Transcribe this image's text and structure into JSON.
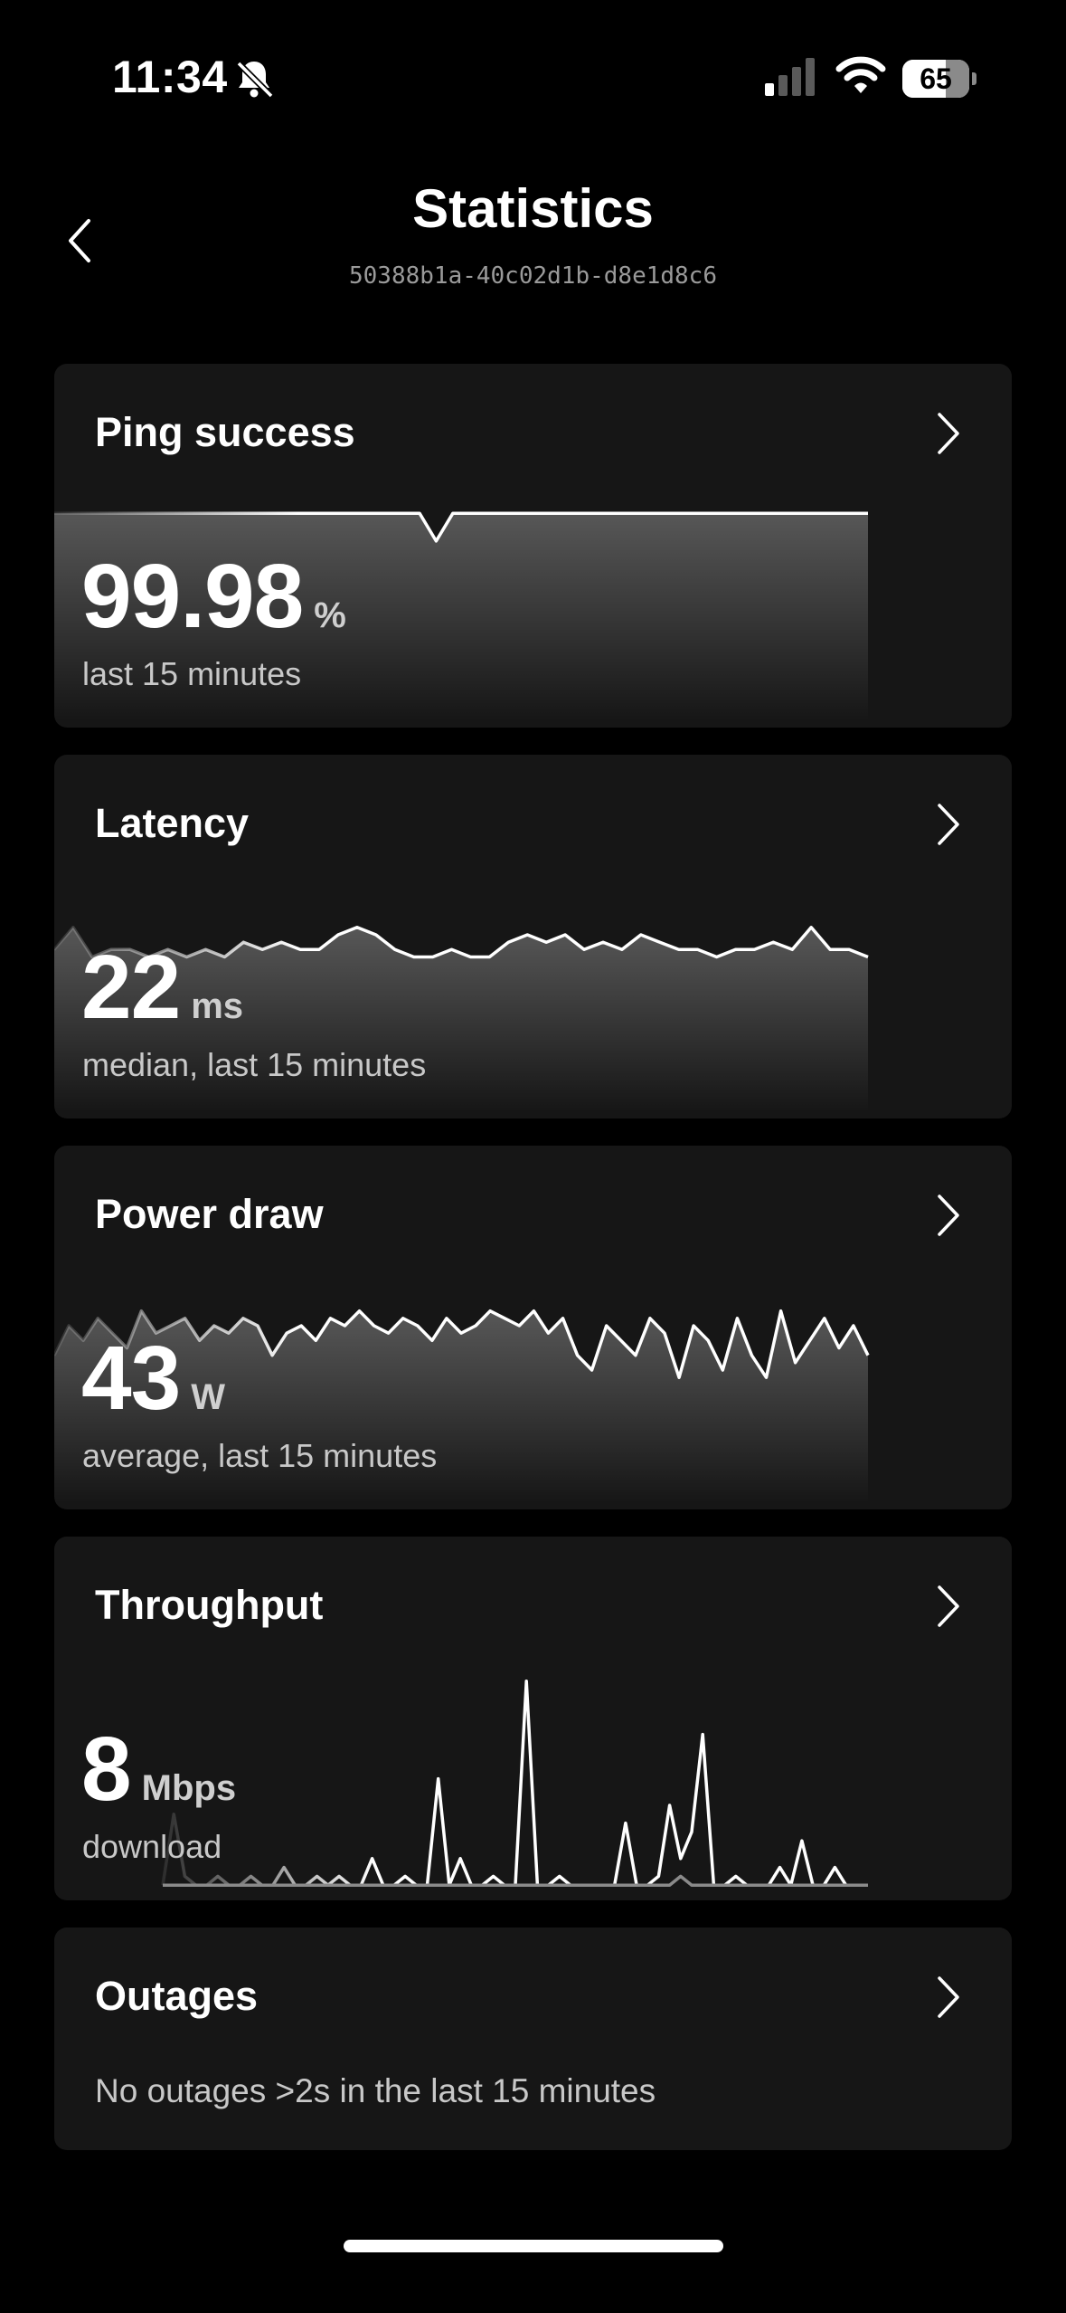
{
  "status_bar": {
    "time": "11:34",
    "battery": "65",
    "icons": [
      "bell-slash-icon",
      "cellular-signal-icon",
      "wifi-icon",
      "battery-icon"
    ]
  },
  "header": {
    "title": "Statistics",
    "subtitle": "50388b1a-40c02d1b-d8e1d8c6",
    "back_icon": "chevron-left-icon"
  },
  "cards": {
    "ping": {
      "title": "Ping success",
      "value": "99.98",
      "unit": "%",
      "caption": "last 15 minutes"
    },
    "latency": {
      "title": "Latency",
      "value": "22",
      "unit": "ms",
      "caption": "median, last 15 minutes"
    },
    "power": {
      "title": "Power draw",
      "value": "43",
      "unit": "W",
      "caption": "average, last 15 minutes"
    },
    "throughput": {
      "title": "Throughput",
      "value": "8",
      "unit": "Mbps",
      "caption": "download"
    },
    "outages": {
      "title": "Outages",
      "caption": "No outages >2s in the last 15 minutes"
    }
  },
  "chart_data": [
    {
      "type": "line",
      "name": "ping-sparkline",
      "values": [
        100,
        100,
        100,
        100,
        100,
        100,
        100,
        100,
        100,
        100,
        100,
        100,
        100,
        100,
        100,
        100,
        100,
        100,
        100,
        100,
        100,
        100,
        100,
        99.6,
        100,
        100,
        100,
        100,
        100,
        100,
        100,
        100,
        100,
        100,
        100,
        100,
        100,
        100,
        100,
        100,
        100,
        100,
        100,
        100,
        100,
        100,
        100,
        100,
        100,
        100
      ],
      "ylim": [
        97,
        100.2
      ]
    },
    {
      "type": "line",
      "name": "latency-sparkline",
      "values": [
        22,
        25,
        21,
        22,
        22,
        21,
        22,
        21,
        22,
        21,
        23,
        22,
        23,
        22,
        22,
        24,
        25,
        24,
        22,
        21,
        21,
        22,
        21,
        21,
        23,
        24,
        23,
        24,
        22,
        23,
        22,
        24,
        23,
        22,
        22,
        21,
        22,
        22,
        23,
        22,
        25,
        22,
        22,
        21
      ],
      "ylim": [
        0,
        30
      ]
    },
    {
      "type": "line",
      "name": "power-sparkline",
      "values": [
        40,
        44,
        42,
        45,
        43,
        41,
        46,
        43,
        44,
        45,
        42,
        44,
        43,
        45,
        44,
        40,
        43,
        44,
        42,
        45,
        44,
        46,
        44,
        43,
        45,
        44,
        42,
        45,
        43,
        44,
        46,
        45,
        44,
        46,
        43,
        45,
        40,
        38,
        44,
        42,
        40,
        45,
        43,
        37,
        44,
        42,
        38,
        45,
        40,
        37,
        46,
        39,
        42,
        45,
        41,
        44,
        40
      ],
      "ylim": [
        20,
        50
      ]
    },
    {
      "type": "line",
      "name": "throughput-download",
      "values": [
        1,
        9,
        2,
        1,
        1,
        2,
        1,
        1,
        2,
        1,
        1,
        3,
        1,
        1,
        2,
        1,
        2,
        1,
        1,
        4,
        1,
        1,
        2,
        1,
        1,
        13,
        1,
        4,
        1,
        1,
        2,
        1,
        1,
        24,
        1,
        1,
        2,
        1,
        1,
        1,
        1,
        1,
        8,
        1,
        1,
        2,
        10,
        4,
        7,
        18,
        1,
        1,
        2,
        1,
        1,
        1,
        3,
        1,
        6,
        1,
        1,
        3,
        1,
        1,
        1
      ],
      "ylim": [
        0,
        25
      ]
    },
    {
      "type": "line",
      "name": "throughput-upload",
      "values": [
        1,
        1,
        1,
        1,
        1,
        1,
        1,
        1,
        1,
        1,
        1,
        1,
        1,
        1,
        1,
        1,
        1,
        1,
        1,
        1,
        1,
        1,
        1,
        1,
        1,
        1,
        1,
        1,
        1,
        1,
        1,
        1,
        1,
        1,
        1,
        1,
        1,
        1,
        1,
        1,
        1,
        1,
        1,
        1,
        1,
        1,
        1,
        2,
        1,
        1,
        1,
        1,
        1,
        1,
        1,
        1,
        1,
        1,
        1,
        1,
        1,
        1,
        1,
        1,
        1
      ],
      "ylim": [
        0,
        25
      ]
    }
  ]
}
